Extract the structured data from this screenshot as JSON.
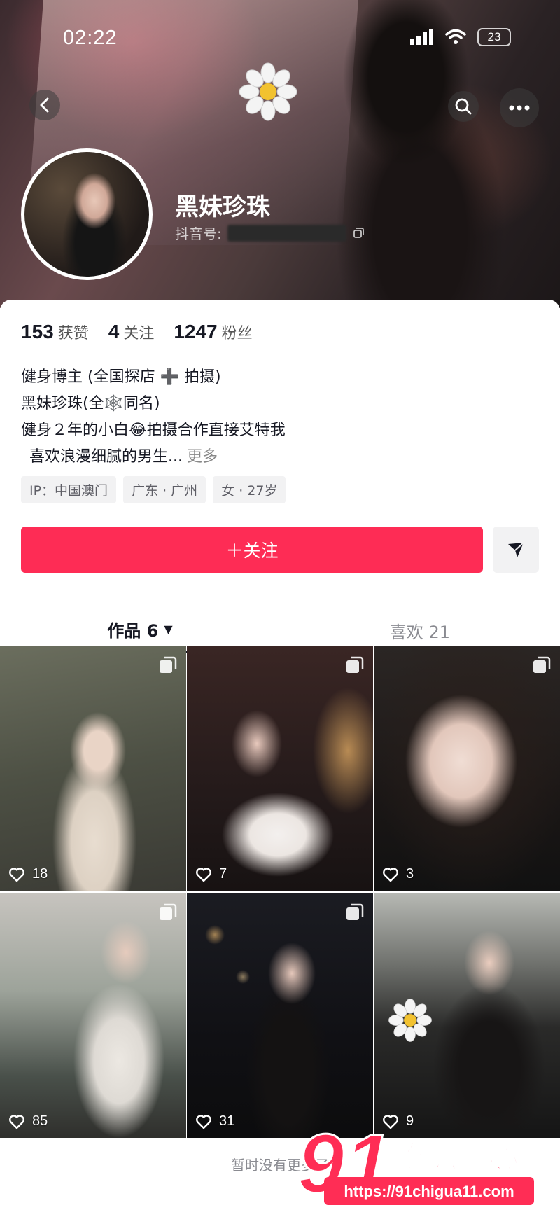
{
  "status_bar": {
    "time": "02:22",
    "battery": "23"
  },
  "profile": {
    "nickname": "黑妹珍珠",
    "douyin_id_label": "抖音号:"
  },
  "stats": [
    {
      "value": "153",
      "label": "获赞"
    },
    {
      "value": "4",
      "label": "关注"
    },
    {
      "value": "1247",
      "label": "粉丝"
    }
  ],
  "bio": {
    "line1": "健身博主 (全国探店 ➕ 拍摄)",
    "line2": "黑妹珍珠(全🕸️同名)",
    "line3": "健身２年的小白😂拍摄合作直接艾特我",
    "line4": "喜欢浪漫细腻的男生...",
    "more": "更多"
  },
  "tags": [
    "IP：中国澳门",
    "广东 · 广州",
    "女 · 27岁"
  ],
  "follow_button": "＋关注",
  "tabs": [
    {
      "label": "作品 6",
      "active": true
    },
    {
      "label": "喜欢 21",
      "active": false
    }
  ],
  "videos": [
    {
      "likes": "18",
      "multi": true
    },
    {
      "likes": "7",
      "multi": true
    },
    {
      "likes": "3",
      "multi": true
    },
    {
      "likes": "85",
      "multi": true
    },
    {
      "likes": "31",
      "multi": true
    },
    {
      "likes": "9",
      "multi": false
    }
  ],
  "footer_note": "暂时没有更多了",
  "watermark": {
    "brand_number": "91",
    "brand_text": "吃瓜中心",
    "url": "https://91chigua11.com"
  },
  "colors": {
    "accent": "#fe2c55",
    "text": "#161823",
    "muted": "#8a8b91"
  }
}
